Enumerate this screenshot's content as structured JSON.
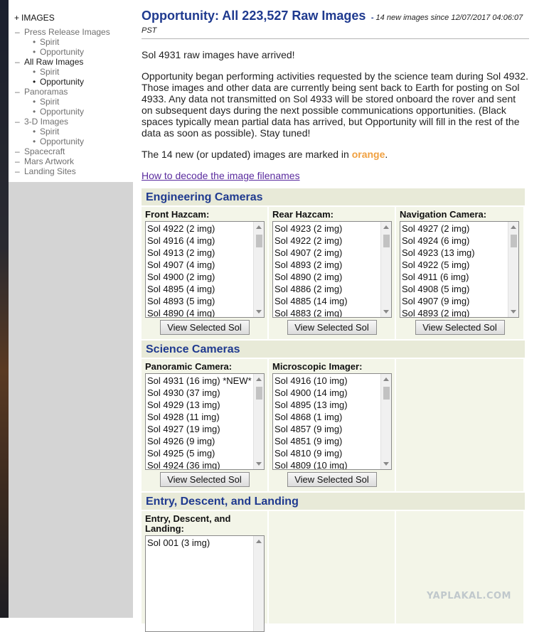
{
  "sidebar": {
    "header": "IMAGES",
    "items": [
      {
        "label": "Press Release Images",
        "level": 1,
        "active": false
      },
      {
        "label": "Spirit",
        "level": 2,
        "active": false
      },
      {
        "label": "Opportunity",
        "level": 2,
        "active": false
      },
      {
        "label": "All Raw Images",
        "level": 1,
        "active": true
      },
      {
        "label": "Spirit",
        "level": 2,
        "active": false
      },
      {
        "label": "Opportunity",
        "level": 2,
        "active": true
      },
      {
        "label": "Panoramas",
        "level": 1,
        "active": false
      },
      {
        "label": "Spirit",
        "level": 2,
        "active": false
      },
      {
        "label": "Opportunity",
        "level": 2,
        "active": false
      },
      {
        "label": "3-D Images",
        "level": 1,
        "active": false
      },
      {
        "label": "Spirit",
        "level": 2,
        "active": false
      },
      {
        "label": "Opportunity",
        "level": 2,
        "active": false
      },
      {
        "label": "Spacecraft",
        "level": 1,
        "active": false
      },
      {
        "label": "Mars Artwork",
        "level": 1,
        "active": false
      },
      {
        "label": "Landing Sites",
        "level": 1,
        "active": false
      }
    ]
  },
  "main": {
    "title": "Opportunity: All 223,527 Raw Images",
    "title_note": "14 new images since 12/07/2017 04:06:07 PST",
    "arrived": "Sol 4931 raw images have arrived!",
    "status": "Opportunity began performing activities requested by the science team during Sol 4932. Those images and other data are currently being sent back to Earth for posting on Sol 4933. Any data not transmitted on Sol 4933 will be stored onboard the rover and sent on subsequent days during the next possible communications opportunities. (Black spaces typically mean partial data has arrived, but Opportunity will fill in the rest of the data as soon as possible). Stay tuned!",
    "new_pre": "The 14 new (or updated) images are marked in ",
    "new_word": "orange",
    "new_post": ".",
    "decode_link": "How to decode the image filenames"
  },
  "view_button": "View Selected Sol",
  "sections": {
    "engineering": {
      "title": "Engineering Cameras",
      "cameras": [
        {
          "label": "Front Hazcam:",
          "items": [
            "Sol 4922 (2 img)",
            "Sol 4916 (4 img)",
            "Sol 4913 (2 img)",
            "Sol 4907 (4 img)",
            "Sol 4900 (2 img)",
            "Sol 4895 (4 img)",
            "Sol 4893 (5 img)",
            "Sol 4890 (4 img)"
          ]
        },
        {
          "label": "Rear Hazcam:",
          "items": [
            "Sol 4923 (2 img)",
            "Sol 4922 (2 img)",
            "Sol 4907 (2 img)",
            "Sol 4893 (2 img)",
            "Sol 4890 (2 img)",
            "Sol 4886 (2 img)",
            "Sol 4885 (14 img)",
            "Sol 4883 (2 img)"
          ]
        },
        {
          "label": "Navigation Camera:",
          "items": [
            "Sol 4927 (2 img)",
            "Sol 4924 (6 img)",
            "Sol 4923 (13 img)",
            "Sol 4922 (5 img)",
            "Sol 4911 (6 img)",
            "Sol 4908 (5 img)",
            "Sol 4907 (9 img)",
            "Sol 4893 (2 img)"
          ]
        }
      ]
    },
    "science": {
      "title": "Science Cameras",
      "cameras": [
        {
          "label": "Panoramic Camera:",
          "items": [
            "Sol 4931 (16 img) *NEW*",
            "Sol 4930 (37 img)",
            "Sol 4929 (13 img)",
            "Sol 4928 (11 img)",
            "Sol 4927 (19 img)",
            "Sol 4926 (9 img)",
            "Sol 4925 (5 img)",
            "Sol 4924 (36 img)"
          ]
        },
        {
          "label": "Microscopic Imager:",
          "items": [
            "Sol 4916 (10 img)",
            "Sol 4900 (14 img)",
            "Sol 4895 (13 img)",
            "Sol 4868 (1 img)",
            "Sol 4857 (9 img)",
            "Sol 4851 (9 img)",
            "Sol 4810 (9 img)",
            "Sol 4809 (10 img)"
          ]
        }
      ]
    },
    "edl": {
      "title": "Entry, Descent, and Landing",
      "cameras": [
        {
          "label": "Entry, Descent, and Landing:",
          "items": [
            "Sol 001 (3 img)"
          ]
        }
      ]
    }
  },
  "watermark": "YAPLAKAL.COM"
}
